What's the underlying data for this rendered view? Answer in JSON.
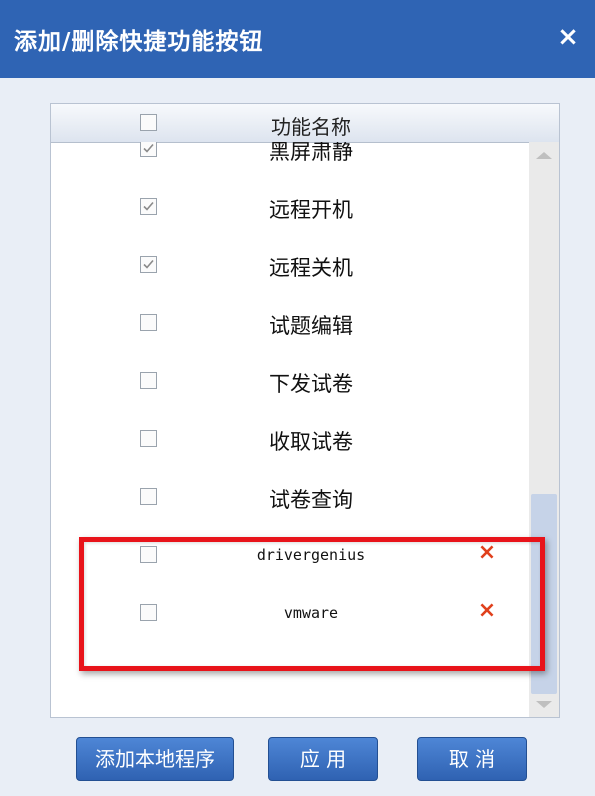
{
  "dialog": {
    "title": "添加/删除快捷功能按钮",
    "close_label": "×"
  },
  "list": {
    "header": {
      "label": "功能名称",
      "checked": false
    },
    "rows": [
      {
        "label": "黑屏肃静",
        "checked": true,
        "deletable": false
      },
      {
        "label": "远程开机",
        "checked": true,
        "deletable": false
      },
      {
        "label": "远程关机",
        "checked": true,
        "deletable": false
      },
      {
        "label": "试题编辑",
        "checked": false,
        "deletable": false
      },
      {
        "label": "下发试卷",
        "checked": false,
        "deletable": false
      },
      {
        "label": "收取试卷",
        "checked": false,
        "deletable": false
      },
      {
        "label": "试卷查询",
        "checked": false,
        "deletable": false
      },
      {
        "label": "drivergenius",
        "checked": false,
        "deletable": true,
        "delete_label": "×"
      },
      {
        "label": "vmware",
        "checked": false,
        "deletable": true,
        "delete_label": "×"
      }
    ]
  },
  "buttons": {
    "add_local": "添加本地程序",
    "apply": "应 用",
    "cancel": "取 消"
  },
  "colors": {
    "title_bar": "#2f64b4",
    "button": "#3a6fc2",
    "delete_icon": "#e0401c",
    "highlight": "#e8131a"
  }
}
